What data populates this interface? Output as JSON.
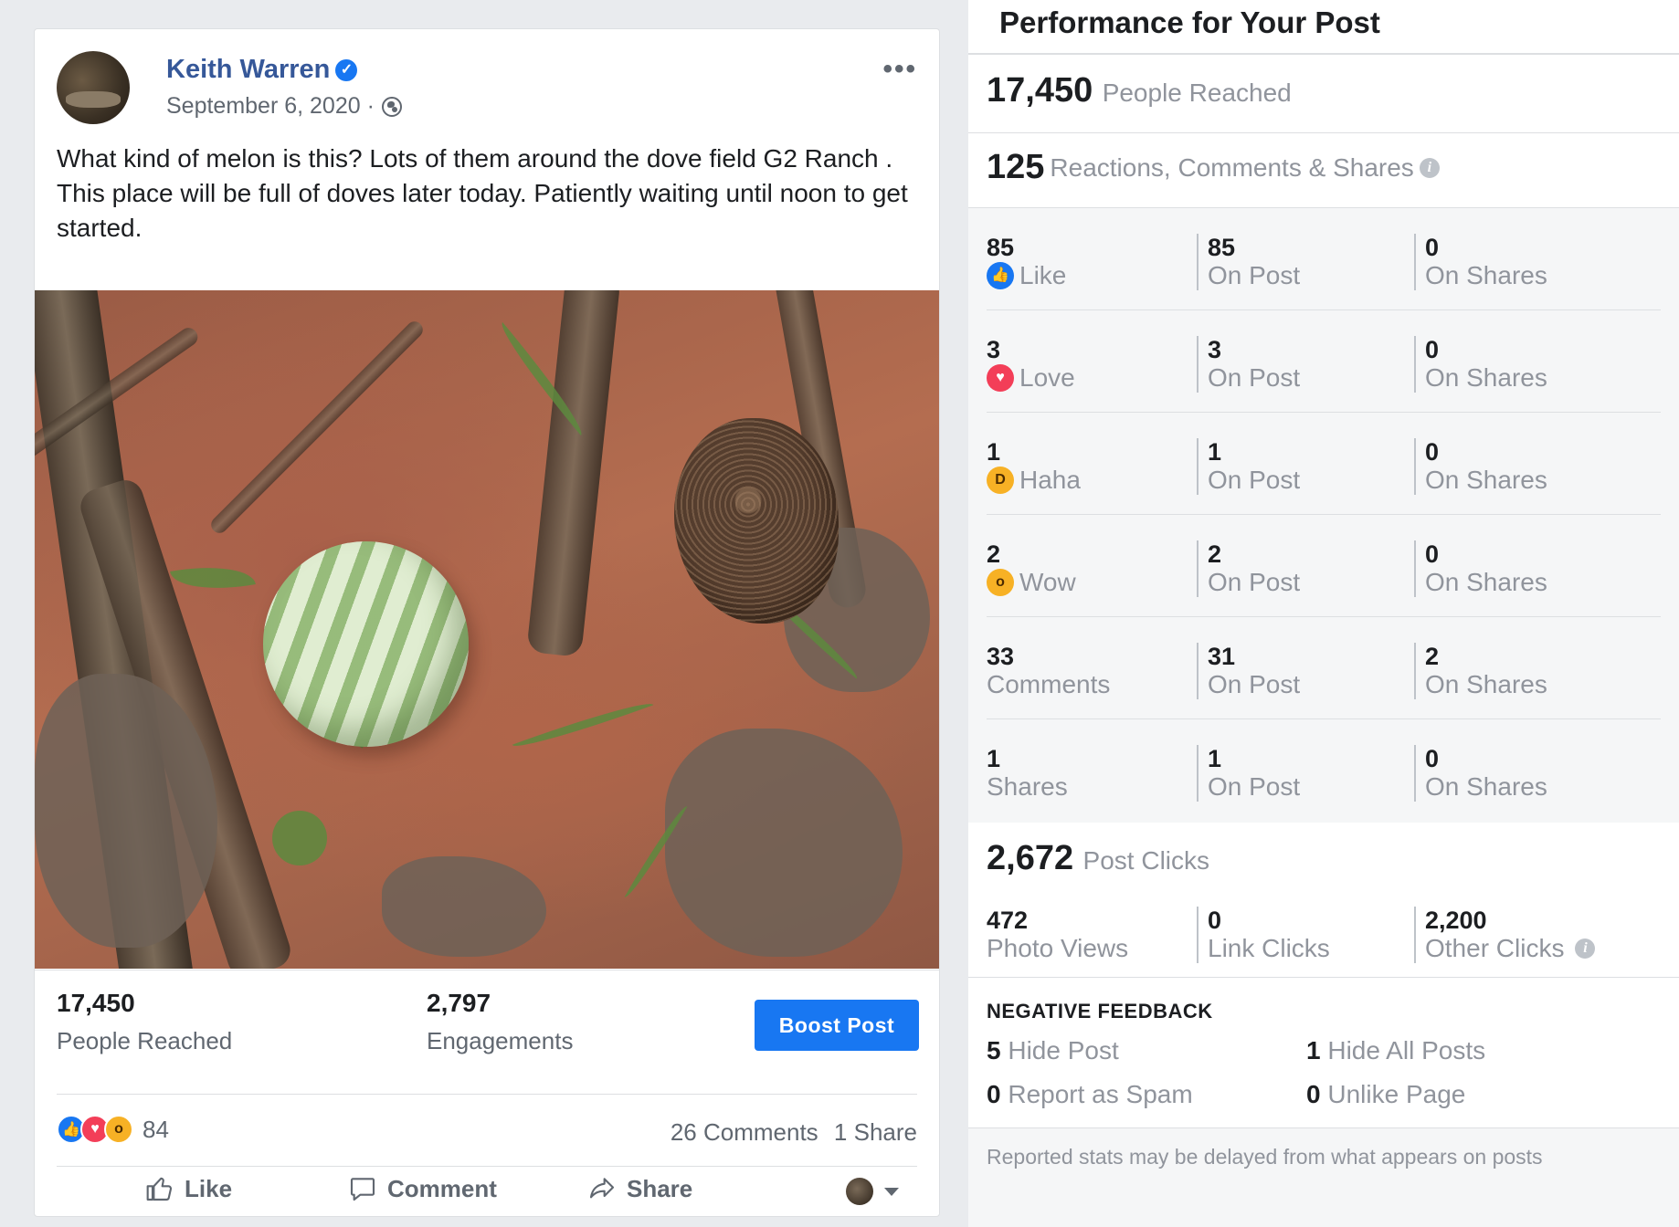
{
  "post": {
    "author": "Keith Warren",
    "date": "September 6, 2020 ·",
    "text": "What kind of melon is this? Lots of them around the dove field G2 Ranch . This place will be full of doves later today. Patiently waiting until noon to get started.",
    "more_label": "•••",
    "stats": {
      "reached_value": "17,450",
      "reached_label": "People Reached",
      "engagements_value": "2,797",
      "engagements_label": "Engagements",
      "boost_label": "Boost Post"
    },
    "reactions": {
      "count": "84",
      "comments": "26 Comments",
      "shares": "1 Share"
    },
    "actions": {
      "like": "Like",
      "comment": "Comment",
      "share": "Share"
    }
  },
  "performance": {
    "title": "Performance for Your Post",
    "reached": {
      "value": "17,450",
      "label": "People Reached"
    },
    "engagement": {
      "value": "125",
      "label": "Reactions, Comments & Shares"
    },
    "rows": [
      {
        "total": "85",
        "label": "Like",
        "icon": "like-icon",
        "on_post": "85",
        "on_shares": "0"
      },
      {
        "total": "3",
        "label": "Love",
        "icon": "love-icon",
        "on_post": "3",
        "on_shares": "0"
      },
      {
        "total": "1",
        "label": "Haha",
        "icon": "haha-icon",
        "on_post": "1",
        "on_shares": "0"
      },
      {
        "total": "2",
        "label": "Wow",
        "icon": "wow-icon",
        "on_post": "2",
        "on_shares": "0"
      },
      {
        "total": "33",
        "label": "Comments",
        "icon": "",
        "on_post": "31",
        "on_shares": "2"
      },
      {
        "total": "1",
        "label": "Shares",
        "icon": "",
        "on_post": "1",
        "on_shares": "0"
      }
    ],
    "on_post_label": "On Post",
    "on_shares_label": "On Shares",
    "clicks": {
      "value": "2,672",
      "label": "Post Clicks",
      "photo_views_value": "472",
      "photo_views_label": "Photo Views",
      "link_clicks_value": "0",
      "link_clicks_label": "Link Clicks",
      "other_clicks_value": "2,200",
      "other_clicks_label": "Other Clicks"
    },
    "negative": {
      "heading": "NEGATIVE FEEDBACK",
      "hide_post_value": "5",
      "hide_post_label": "Hide Post",
      "hide_all_value": "1",
      "hide_all_label": "Hide All Posts",
      "spam_value": "0",
      "spam_label": "Report as Spam",
      "unlike_value": "0",
      "unlike_label": "Unlike Page"
    },
    "footnote": "Reported stats may be delayed from what appears on posts"
  },
  "colors": {
    "accent": "#1877f2",
    "author_link": "#365899",
    "muted_text": "#90949c",
    "love": "#f33e58",
    "haha_wow": "#f7b125"
  }
}
